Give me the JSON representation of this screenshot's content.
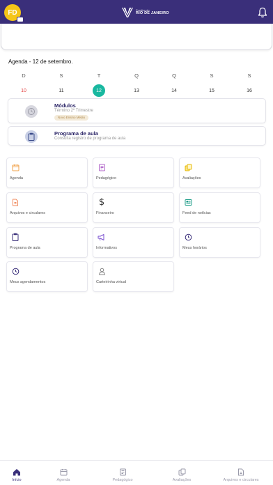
{
  "header": {
    "avatar_initials": "FD",
    "logo_small": "Positivo do",
    "logo_big": "RIO DE JANEIRO",
    "brand_color": "#3a2f7a",
    "notification_icon": "bell-icon"
  },
  "agenda": {
    "title": "Agenda - 12 de setembro.",
    "days": [
      {
        "letter": "D",
        "num": "10"
      },
      {
        "letter": "S",
        "num": "11"
      },
      {
        "letter": "T",
        "num": "12"
      },
      {
        "letter": "Q",
        "num": "13"
      },
      {
        "letter": "Q",
        "num": "14"
      },
      {
        "letter": "S",
        "num": "15"
      },
      {
        "letter": "S",
        "num": "16"
      }
    ],
    "selected_day": "12",
    "selected_color": "#19b8a0",
    "sunday_color": "#e23b3b"
  },
  "modules_card": {
    "title": "Módulos",
    "subtitle": "Término 2º Trimestre",
    "tag": "Novo Ensino Médio",
    "icon": "clock-icon"
  },
  "program_card": {
    "title": "Programa de aula",
    "subtitle": "Consulta registro de programa de aula",
    "icon": "clipboard-icon"
  },
  "tiles": [
    {
      "label": "Agenda",
      "icon": "calendar-icon",
      "color": "#f0a24a"
    },
    {
      "label": "Pedagógico",
      "icon": "book-icon",
      "color": "#b266c9"
    },
    {
      "label": "Avaliações",
      "icon": "copy-icon",
      "color": "#e6b800"
    },
    {
      "label": "Arquivos e circulares",
      "icon": "file-icon",
      "color": "#f08a5d"
    },
    {
      "label": "Financeiro",
      "icon": "dollar-icon",
      "color": "#333333"
    },
    {
      "label": "Feed de notícias",
      "icon": "newspaper-icon",
      "color": "#1f9e89"
    },
    {
      "label": "Programa de aula",
      "icon": "clipboard-icon",
      "color": "#3a2f7a"
    },
    {
      "label": "Informativos",
      "icon": "megaphone-icon",
      "color": "#7a4fd0"
    },
    {
      "label": "Meus horários",
      "icon": "clock-icon",
      "color": "#3a2f7a"
    },
    {
      "label": "Meus agendamentos",
      "icon": "clock-icon",
      "color": "#3a2f7a"
    },
    {
      "label": "Carteirinha virtual",
      "icon": "user-icon",
      "color": "#888888"
    }
  ],
  "bottom_nav": [
    {
      "label": "Início",
      "icon": "home-icon",
      "active": true
    },
    {
      "label": "Agenda",
      "icon": "calendar-icon",
      "active": false
    },
    {
      "label": "Pedagógico",
      "icon": "book-icon",
      "active": false
    },
    {
      "label": "Avaliações",
      "icon": "copy-icon",
      "active": false
    },
    {
      "label": "Arquivos e circulares",
      "icon": "file-icon",
      "active": false
    }
  ]
}
